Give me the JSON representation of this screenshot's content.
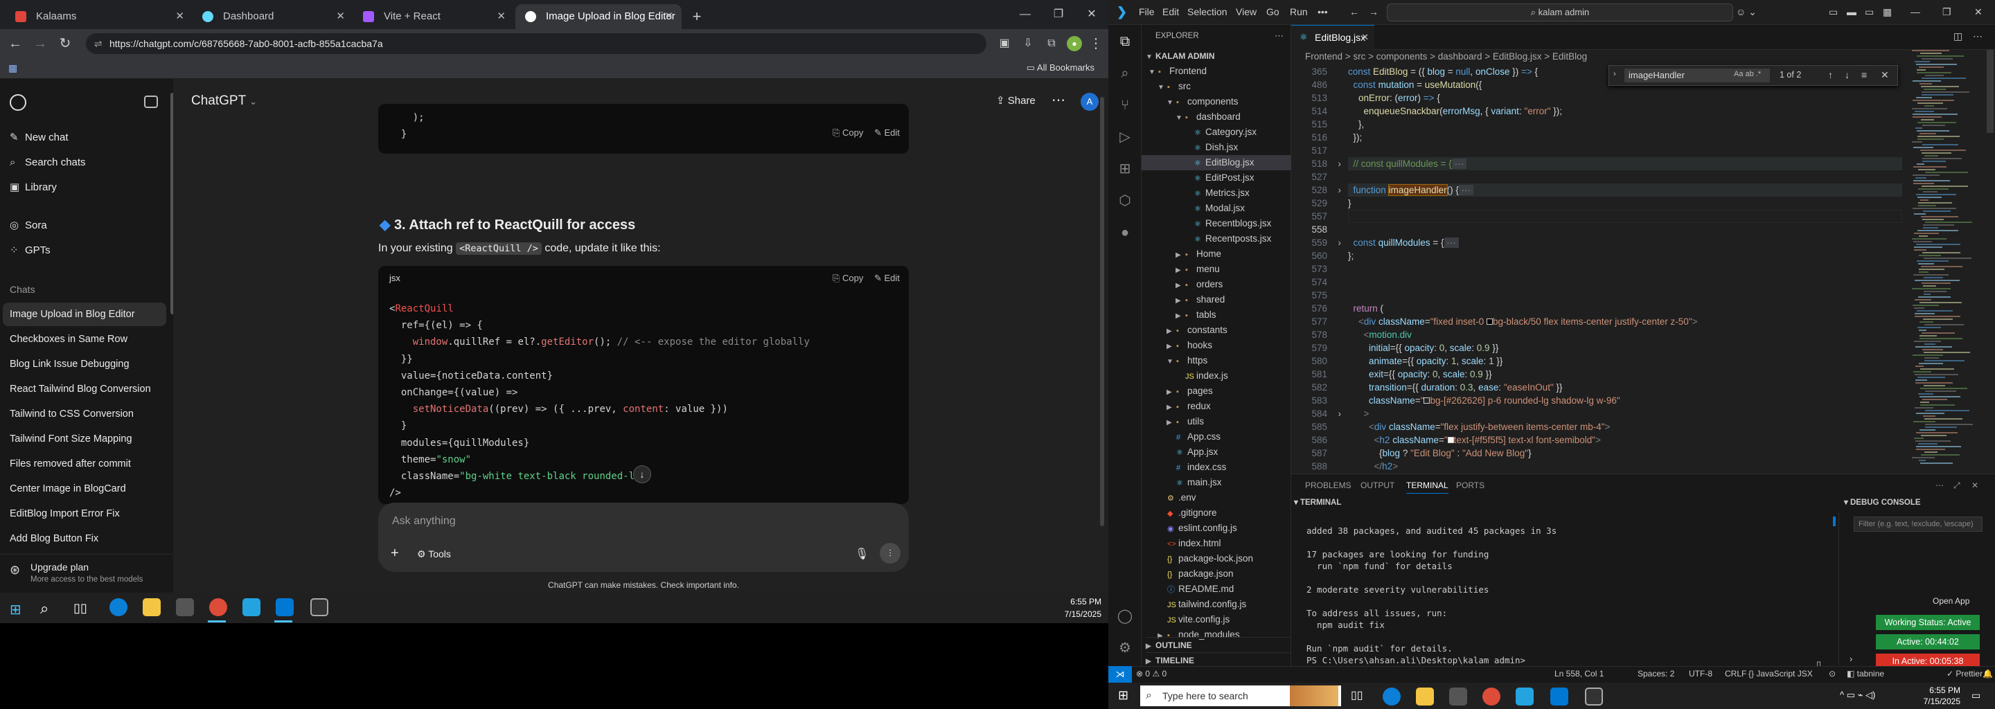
{
  "chrome": {
    "tabs": [
      {
        "title": "Kalaams",
        "color": "#e0443b"
      },
      {
        "title": "Dashboard",
        "color": "#61dafb"
      },
      {
        "title": "Vite + React",
        "color": "#a259ff"
      },
      {
        "title": "Image Upload in Blog Editor",
        "color": "#cccccc"
      }
    ],
    "url": "https://chatgpt.com/c/68765668-7ab0-8001-acfb-855a1cacba7a",
    "bookmarks_all": "All Bookmarks"
  },
  "chatgpt": {
    "model_title": "ChatGPT",
    "share_label": "Share",
    "avatar_letter": "A",
    "sidebar": {
      "new_chat": "New chat",
      "search_chats": "Search chats",
      "library": "Library",
      "sora": "Sora",
      "gpts": "GPTs",
      "chats_heading": "Chats",
      "chats": [
        "Image Upload in Blog Editor",
        "Checkboxes in Same Row",
        "Blog Link Issue Debugging",
        "React Tailwind Blog Conversion",
        "Tailwind to CSS Conversion",
        "Tailwind Font Size Mapping",
        "Files removed after commit",
        "Center Image in BlogCard",
        "EditBlog Import Error Fix",
        "Add Blog Button Fix"
      ],
      "upgrade_title": "Upgrade plan",
      "upgrade_sub": "More access to the best models"
    },
    "code_top_lines": [
      "    );",
      "  }"
    ],
    "copy_label": "Copy",
    "edit_label": "Edit",
    "section_heading": "3. Attach ref to ReactQuill for access",
    "section_text_pre": "In your existing",
    "section_code_inline": "<ReactQuill />",
    "section_text_post": "code, update it like this:",
    "code_lang": "jsx",
    "composer_placeholder": "Ask anything",
    "tools_label": "Tools",
    "disclaimer": "ChatGPT can make mistakes. Check important info."
  },
  "taskbar_left": {
    "time": "6:55 PM",
    "date": "7/15/2025"
  },
  "vscode": {
    "menus": [
      "File",
      "Edit",
      "Selection",
      "View",
      "Go",
      "Run",
      "•••"
    ],
    "search_text": "kalam admin",
    "explorer_title": "EXPLORER",
    "root_folder": "KALAM ADMIN",
    "tree": [
      {
        "label": "Frontend",
        "type": "folder-open",
        "indent": 0
      },
      {
        "label": "src",
        "type": "folder-open",
        "indent": 1
      },
      {
        "label": "components",
        "type": "folder-open",
        "indent": 2
      },
      {
        "label": "dashboard",
        "type": "folder-open",
        "indent": 3
      },
      {
        "label": "Category.jsx",
        "type": "jsx",
        "indent": 4
      },
      {
        "label": "Dish.jsx",
        "type": "jsx",
        "indent": 4
      },
      {
        "label": "EditBlog.jsx",
        "type": "jsx",
        "indent": 4,
        "selected": true
      },
      {
        "label": "EditPost.jsx",
        "type": "jsx",
        "indent": 4
      },
      {
        "label": "Metrics.jsx",
        "type": "jsx",
        "indent": 4
      },
      {
        "label": "Modal.jsx",
        "type": "jsx",
        "indent": 4
      },
      {
        "label": "Recentblogs.jsx",
        "type": "jsx",
        "indent": 4
      },
      {
        "label": "Recentposts.jsx",
        "type": "jsx",
        "indent": 4
      },
      {
        "label": "Home",
        "type": "folder",
        "indent": 3
      },
      {
        "label": "menu",
        "type": "folder",
        "indent": 3
      },
      {
        "label": "orders",
        "type": "folder",
        "indent": 3
      },
      {
        "label": "shared",
        "type": "folder",
        "indent": 3
      },
      {
        "label": "tabls",
        "type": "folder",
        "indent": 3
      },
      {
        "label": "constants",
        "type": "folder",
        "indent": 2
      },
      {
        "label": "hooks",
        "type": "folder",
        "indent": 2
      },
      {
        "label": "https",
        "type": "folder-open",
        "indent": 2
      },
      {
        "label": "index.js",
        "type": "js",
        "indent": 3
      },
      {
        "label": "pages",
        "type": "folder",
        "indent": 2
      },
      {
        "label": "redux",
        "type": "folder",
        "indent": 2
      },
      {
        "label": "utils",
        "type": "folder",
        "indent": 2
      },
      {
        "label": "App.css",
        "type": "css",
        "indent": 2
      },
      {
        "label": "App.jsx",
        "type": "jsx",
        "indent": 2
      },
      {
        "label": "index.css",
        "type": "css",
        "indent": 2
      },
      {
        "label": "main.jsx",
        "type": "jsx",
        "indent": 2
      },
      {
        "label": ".env",
        "type": "env",
        "indent": 1
      },
      {
        "label": ".gitignore",
        "type": "git",
        "indent": 1
      },
      {
        "label": "eslint.config.js",
        "type": "eslint",
        "indent": 1
      },
      {
        "label": "index.html",
        "type": "html",
        "indent": 1
      },
      {
        "label": "package-lock.json",
        "type": "json",
        "indent": 1
      },
      {
        "label": "package.json",
        "type": "json",
        "indent": 1
      },
      {
        "label": "README.md",
        "type": "md",
        "indent": 1
      },
      {
        "label": "tailwind.config.js",
        "type": "js",
        "indent": 1
      },
      {
        "label": "vite.config.js",
        "type": "js",
        "indent": 1
      },
      {
        "label": "node_modules",
        "type": "folder",
        "indent": 1
      }
    ],
    "outline": "OUTLINE",
    "timeline": "TIMELINE",
    "editor_tab": "EditBlog.jsx",
    "breadcrumb": "Frontend > src > components > dashboard > EditBlog.jsx > EditBlog",
    "find_text": "imageHandler",
    "find_count": "1 of 2",
    "line_numbers": [
      "365",
      "486",
      "513",
      "514",
      "515",
      "516",
      "517",
      "518",
      "527",
      "528",
      "529",
      "557",
      "558",
      "559",
      "560",
      "573",
      "574",
      "575",
      "576",
      "577",
      "578",
      "579",
      "580",
      "581",
      "582",
      "583",
      "584",
      "585",
      "586",
      "587",
      "588"
    ],
    "panel_tabs": [
      "PROBLEMS",
      "OUTPUT",
      "TERMINAL",
      "PORTS"
    ],
    "terminal_title": "TERMINAL",
    "debug_title": "DEBUG CONSOLE",
    "debug_filter": "Filter (e.g. text, !exclude, \\escape)",
    "terminal_lines": [
      "added 38 packages, and audited 45 packages in 3s",
      "",
      "17 packages are looking for funding",
      "  run `npm fund` for details",
      "",
      "2 moderate severity vulnerabilities",
      "",
      "To address all issues, run:",
      "  npm audit fix",
      "",
      "Run `npm audit` for details.",
      "PS C:\\Users\\ahsan.ali\\Desktop\\kalam admin> "
    ],
    "open_app": "Open App",
    "working_status": "Working Status: Active",
    "active_time": "Active: 00:44:02",
    "inactive_time": "In Active: 00:05:38",
    "status": {
      "errors": "⊗ 0 ⚠ 0",
      "cursor": "Ln 558, Col 1",
      "spaces": "Spaces: 2",
      "encoding": "UTF-8",
      "eol": "CRLF",
      "lang": "{} JavaScript JSX",
      "tabnine": "tabnine",
      "prettier": "Prettier"
    }
  },
  "taskbar_right": {
    "search_placeholder": "Type here to search",
    "time": "6:55 PM",
    "date": "7/15/2025"
  }
}
